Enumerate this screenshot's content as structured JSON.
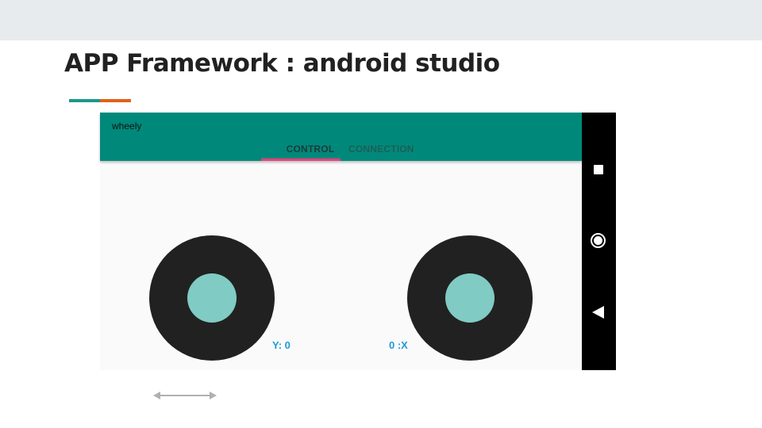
{
  "slide": {
    "title": "APP Framework : android studio",
    "accent_colors": [
      "#1b998b",
      "#e0611a"
    ]
  },
  "app": {
    "title": "wheely",
    "tabs": [
      {
        "label": "CONTROL",
        "selected": true
      },
      {
        "label": "CONNECTION",
        "selected": false
      }
    ],
    "colors": {
      "app_bar": "#00897b",
      "tab_selected_text": "#1e3a36",
      "tab_unselected_text": "#1f5e55",
      "tab_indicator": "#ec407a",
      "joystick_knob": "#80cbc4",
      "readout_text": "#1e9bd7"
    },
    "readouts": {
      "y_label": "Y: 0",
      "x_label": "0 :X"
    },
    "joysticks": [
      {
        "name": "left-joystick"
      },
      {
        "name": "right-joystick"
      }
    ]
  },
  "navigation_bar": {
    "icons": [
      "recents-square-icon",
      "home-circle-icon",
      "back-triangle-icon"
    ]
  },
  "decorations": {
    "double_arrow_icon": "double-headed-arrow-icon",
    "double_arrow_color": "#b0b0b0"
  }
}
